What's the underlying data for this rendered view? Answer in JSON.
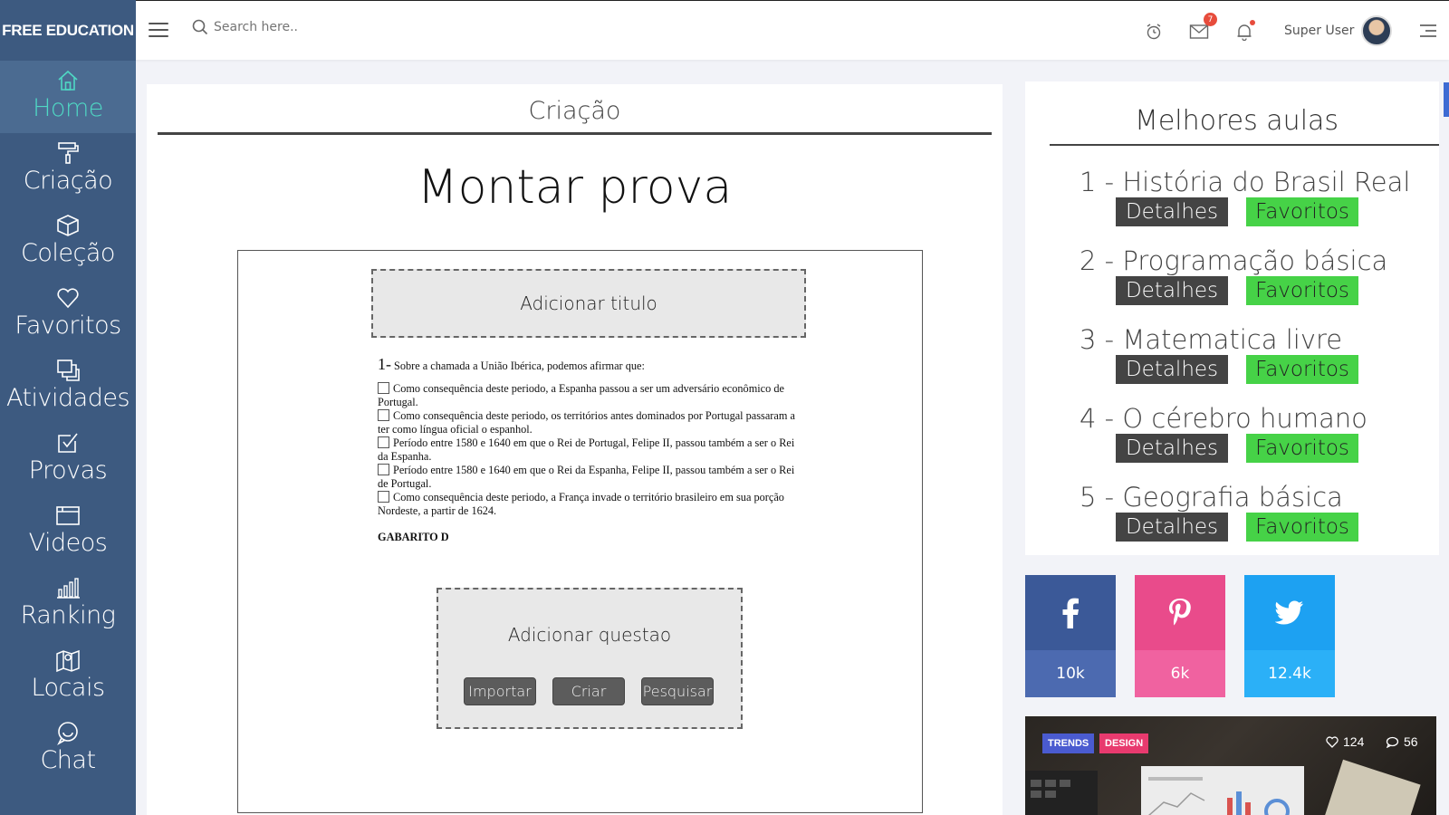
{
  "brand": "FREE EDUCATION",
  "search": {
    "placeholder": "Search here.."
  },
  "header": {
    "mail_badge": "7",
    "user_name": "Super User"
  },
  "sidebar": {
    "items": [
      {
        "label": "Home",
        "icon": "home-icon",
        "active": true
      },
      {
        "label": "Criação",
        "icon": "paint-roller-icon"
      },
      {
        "label": "Coleção",
        "icon": "box-icon"
      },
      {
        "label": "Favoritos",
        "icon": "heart-icon"
      },
      {
        "label": "Atividades",
        "icon": "copy-icon"
      },
      {
        "label": "Provas",
        "icon": "checkbox-icon"
      },
      {
        "label": "Videos",
        "icon": "browser-icon"
      },
      {
        "label": "Ranking",
        "icon": "bar-chart-icon"
      },
      {
        "label": "Locais",
        "icon": "map-icon"
      },
      {
        "label": "Chat",
        "icon": "chat-icon"
      }
    ]
  },
  "main": {
    "section_title": "Criação",
    "page_title": "Montar prova",
    "add_title_label": "Adicionar titulo",
    "question": {
      "number": "1-",
      "text": "Sobre a chamada a União Ibérica, podemos afirmar que:",
      "options": [
        "Como consequência deste periodo, a Espanha passou a ser um adversário econômico de Portugal.",
        "Como consequência deste periodo, os territórios antes dominados por Portugal passaram a ter como língua oficial o espanhol.",
        "Período entre 1580 e 1640 em que o Rei de Portugal, Felipe II, passou também a ser o Rei da Espanha.",
        "Período entre 1580 e 1640 em que o Rei da Espanha, Felipe II, passou também a ser o Rei de Portugal.",
        "Como consequência deste periodo, a França invade o território brasileiro em sua porção Nordeste, a partir de 1624."
      ],
      "answer": "GABARITO D"
    },
    "add_question": {
      "label": "Adicionar questao",
      "import_label": "Importar",
      "create_label": "Criar",
      "search_label": "Pesquisar"
    }
  },
  "best_lessons": {
    "title": "Melhores aulas",
    "details_label": "Detalhes",
    "favorites_label": "Favoritos",
    "items": [
      "1 - História do Brasil Real",
      "2 - Programação básica",
      "3 - Matematica livre",
      "4 - O cérebro humano",
      "5 - Geografia básica"
    ]
  },
  "social": [
    {
      "network": "facebook",
      "icon": "facebook-icon",
      "count": "10k",
      "color_top": "#3b5998",
      "color_bottom": "#4c6ab0"
    },
    {
      "network": "pinterest",
      "icon": "pinterest-icon",
      "count": "6k",
      "color_top": "#e94b8b",
      "color_bottom": "#f062a0"
    },
    {
      "network": "twitter",
      "icon": "twitter-icon",
      "count": "12.4k",
      "color_top": "#1da1f2",
      "color_bottom": "#2bb0f7"
    }
  ],
  "trends_card": {
    "tag1": "TRENDS",
    "tag2": "DESIGN",
    "likes": "124",
    "comments": "56"
  },
  "colors": {
    "sidebar": "#3d5a80",
    "active_text": "#4fd8c4",
    "details_button": "#444444",
    "favorites_button": "#46d247"
  }
}
